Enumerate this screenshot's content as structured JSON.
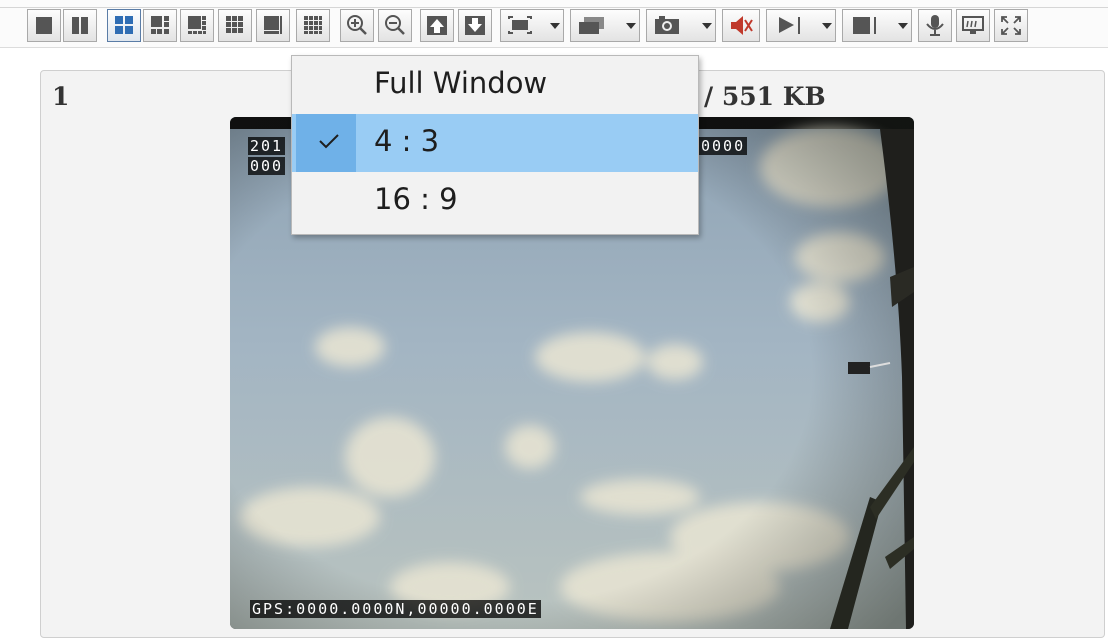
{
  "toolbar": {
    "buttons": [
      {
        "name": "layout-1-button",
        "icon": "single-view-icon"
      },
      {
        "name": "layout-2-button",
        "icon": "two-view-icon"
      },
      {
        "name": "layout-4-button",
        "icon": "four-view-icon",
        "selected": true
      },
      {
        "name": "layout-6-button",
        "icon": "six-view-icon"
      },
      {
        "name": "layout-8-button",
        "icon": "eight-view-icon"
      },
      {
        "name": "layout-9-button",
        "icon": "nine-view-icon"
      },
      {
        "name": "layout-10-button",
        "icon": "ten-view-icon"
      },
      {
        "name": "layout-16-button",
        "icon": "sixteen-view-icon"
      },
      {
        "name": "zoom-in-button",
        "icon": "zoom-in-icon"
      },
      {
        "name": "zoom-out-button",
        "icon": "zoom-out-icon"
      },
      {
        "name": "previous-page-button",
        "icon": "arrow-up-icon"
      },
      {
        "name": "next-page-button",
        "icon": "arrow-down-icon"
      },
      {
        "name": "aspect-ratio-button",
        "icon": "aspect-ratio-icon"
      },
      {
        "name": "window-mode-button",
        "icon": "window-icon"
      },
      {
        "name": "snapshot-button",
        "icon": "camera-icon"
      },
      {
        "name": "mute-button",
        "icon": "speaker-muted-icon"
      },
      {
        "name": "play-button",
        "icon": "play-icon"
      },
      {
        "name": "stop-button",
        "icon": "stop-icon"
      },
      {
        "name": "intercom-button",
        "icon": "microphone-icon"
      },
      {
        "name": "monitor-button",
        "icon": "monitor-icon"
      },
      {
        "name": "fullscreen-button",
        "icon": "fullscreen-icon"
      }
    ],
    "accent": "#2e6db4"
  },
  "panel": {
    "channel_number": "1",
    "size_label": "/ 551 KB"
  },
  "video": {
    "osd_top_line1_left": "201",
    "osd_top_line2_left": "000",
    "osd_top_line1_right": "0000",
    "osd_gps": "GPS:0000.0000N,00000.0000E"
  },
  "aspect_menu": {
    "items": [
      {
        "label": "Full Window",
        "selected": false
      },
      {
        "label": "4 : 3",
        "selected": true
      },
      {
        "label": "16 : 9",
        "selected": false
      }
    ],
    "highlight_color": "#99ccf4"
  }
}
